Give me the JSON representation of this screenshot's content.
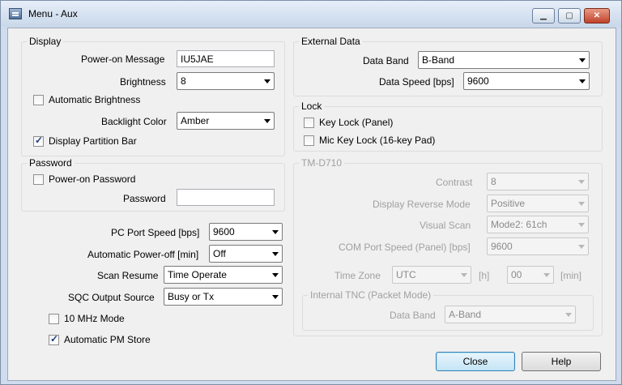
{
  "window": {
    "title": "Menu - Aux",
    "minimize_icon": "minimize-icon",
    "maximize_icon": "maximize-icon",
    "close_icon": "close-icon"
  },
  "display": {
    "legend": "Display",
    "power_on_message_label": "Power-on Message",
    "power_on_message_value": "IU5JAE",
    "brightness_label": "Brightness",
    "brightness_value": "8",
    "automatic_brightness_label": "Automatic Brightness",
    "automatic_brightness_checked": false,
    "backlight_color_label": "Backlight Color",
    "backlight_color_value": "Amber",
    "display_partition_bar_label": "Display Partition Bar",
    "display_partition_bar_checked": true
  },
  "password": {
    "legend": "Password",
    "power_on_password_label": "Power-on Password",
    "power_on_password_checked": false,
    "password_label": "Password",
    "password_value": ""
  },
  "misc": {
    "pc_port_speed_label": "PC Port Speed [bps]",
    "pc_port_speed_value": "9600",
    "auto_power_off_label": "Automatic Power-off [min]",
    "auto_power_off_value": "Off",
    "scan_resume_label": "Scan Resume",
    "scan_resume_value": "Time Operate",
    "sqc_output_source_label": "SQC Output Source",
    "sqc_output_source_value": "Busy or Tx",
    "ten_mhz_mode_label": "10 MHz Mode",
    "ten_mhz_mode_checked": false,
    "auto_pm_store_label": "Automatic PM Store",
    "auto_pm_store_checked": true
  },
  "external_data": {
    "legend": "External Data",
    "data_band_label": "Data Band",
    "data_band_value": "B-Band",
    "data_speed_label": "Data Speed [bps]",
    "data_speed_value": "9600"
  },
  "lock": {
    "legend": "Lock",
    "key_lock_label": "Key Lock (Panel)",
    "key_lock_checked": false,
    "mic_key_lock_label": "Mic Key Lock (16-key Pad)",
    "mic_key_lock_checked": false
  },
  "tm_d710": {
    "legend": "TM-D710",
    "contrast_label": "Contrast",
    "contrast_value": "8",
    "display_reverse_mode_label": "Display Reverse Mode",
    "display_reverse_mode_value": "Positive",
    "visual_scan_label": "Visual Scan",
    "visual_scan_value": "Mode2: 61ch",
    "com_port_speed_label": "COM Port Speed (Panel) [bps]",
    "com_port_speed_value": "9600",
    "time_zone_label": "Time Zone",
    "time_zone_value": "UTC",
    "hour_unit": "[h]",
    "minute_value": "00",
    "minute_unit": "[min]",
    "internal_tnc": {
      "legend": "Internal TNC (Packet Mode)",
      "data_band_label": "Data Band",
      "data_band_value": "A-Band"
    }
  },
  "buttons": {
    "close_label": "Close",
    "help_label": "Help"
  }
}
